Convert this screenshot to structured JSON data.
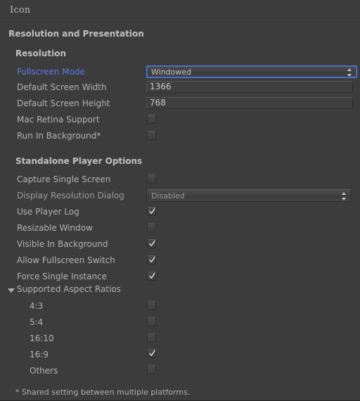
{
  "window": {
    "title": "Icon"
  },
  "colors": {
    "background": "#3c3c3c",
    "label": "#b2b2b2",
    "modified_label": "#5c7de8",
    "accent_focus": "#4a78d8",
    "border": "#2b2b2b"
  },
  "sections": {
    "resolution_and_presentation": {
      "title": "Resolution and Presentation",
      "resolution": {
        "title": "Resolution",
        "fields": {
          "fullscreen_mode": {
            "label": "Fullscreen Mode",
            "value": "Windowed",
            "options": [
              "Windowed"
            ]
          },
          "default_screen_width": {
            "label": "Default Screen Width",
            "value": "1366"
          },
          "default_screen_height": {
            "label": "Default Screen Height",
            "value": "768"
          },
          "mac_retina_support": {
            "label": "Mac Retina Support",
            "checked": false
          },
          "run_in_background": {
            "label": "Run In Background*",
            "checked": false
          }
        }
      },
      "standalone_player_options": {
        "title": "Standalone Player Options",
        "fields": {
          "capture_single_screen": {
            "label": "Capture Single Screen",
            "checked": false
          },
          "display_resolution_dialog": {
            "label": "Display Resolution Dialog",
            "value": "Disabled",
            "options": [
              "Disabled"
            ]
          },
          "use_player_log": {
            "label": "Use Player Log",
            "checked": true
          },
          "resizable_window": {
            "label": "Resizable Window",
            "checked": false
          },
          "visible_in_background": {
            "label": "Visible In Background",
            "checked": true
          },
          "allow_fullscreen_switch": {
            "label": "Allow Fullscreen Switch",
            "checked": true
          },
          "force_single_instance": {
            "label": "Force Single Instance",
            "checked": true
          }
        },
        "supported_aspect_ratios": {
          "label": "Supported Aspect Ratios",
          "expanded": true,
          "items": [
            {
              "label": "4:3",
              "checked": false
            },
            {
              "label": "5:4",
              "checked": false
            },
            {
              "label": "16:10",
              "checked": false
            },
            {
              "label": "16:9",
              "checked": true
            },
            {
              "label": "Others",
              "checked": false
            }
          ]
        }
      }
    }
  },
  "footer": {
    "note": "* Shared setting between multiple platforms."
  }
}
